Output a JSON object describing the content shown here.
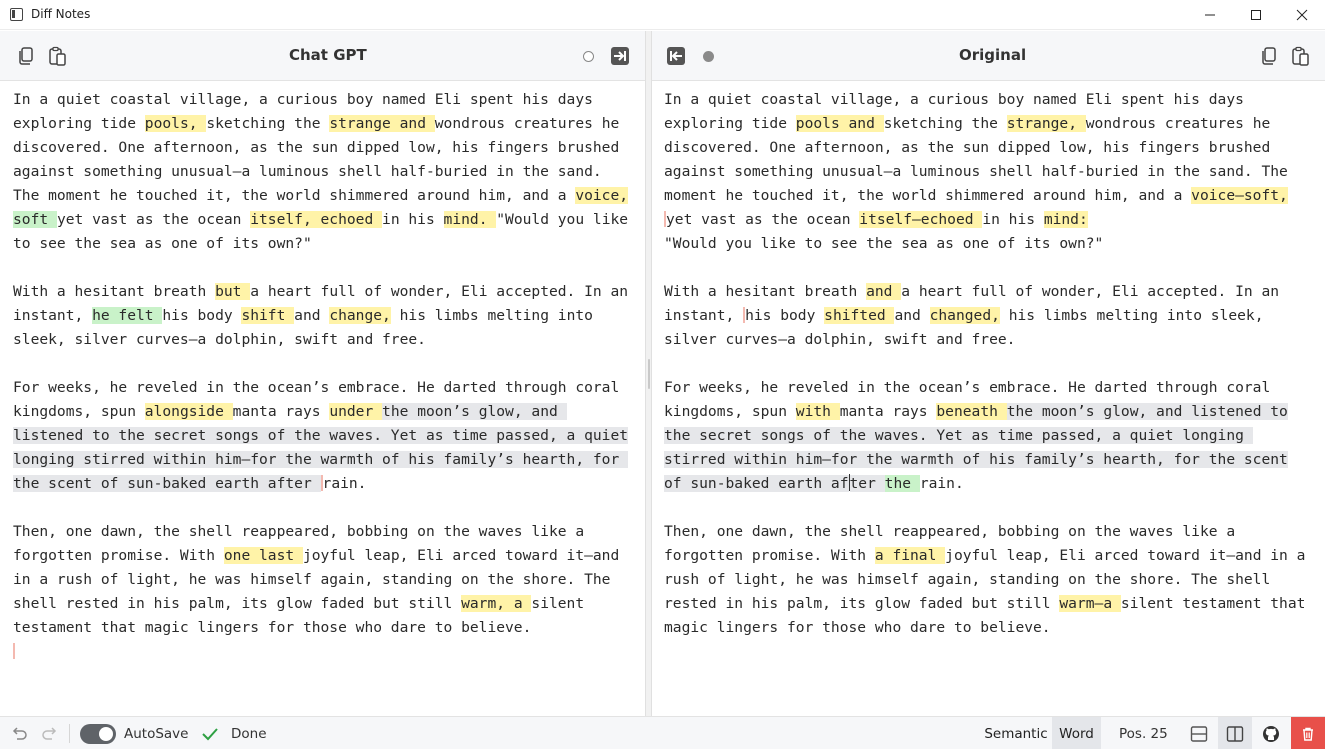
{
  "window": {
    "title": "Diff Notes"
  },
  "left_pane": {
    "title": "Chat GPT",
    "lines": [
      [
        {
          "t": "In a quiet coastal village, a curious boy named Eli spent his days"
        }
      ],
      [
        {
          "t": "exploring tide "
        },
        {
          "t": "pools, ",
          "h": "chg"
        },
        {
          "t": "sketching the "
        },
        {
          "t": "strange and ",
          "h": "chg"
        },
        {
          "t": "wondrous creatures he"
        }
      ],
      [
        {
          "t": "discovered. One afternoon, as the sun dipped low, his fingers brushed"
        }
      ],
      [
        {
          "t": "against something unusual—a luminous shell half-buried in the sand."
        }
      ],
      [
        {
          "t": "The moment he touched it, the world shimmered around him, and a "
        },
        {
          "t": "voice,",
          "h": "chg"
        }
      ],
      [
        {
          "t": "soft ",
          "h": "add"
        },
        {
          "t": "yet vast as the ocean "
        },
        {
          "t": "itself, echoed ",
          "h": "chg"
        },
        {
          "t": "in his "
        },
        {
          "t": "mind. ",
          "h": "chg"
        },
        {
          "t": "\"Would you like"
        }
      ],
      [
        {
          "t": "to see the sea as one of its own?\""
        }
      ],
      [],
      [
        {
          "t": "With a hesitant breath "
        },
        {
          "t": "but ",
          "h": "chg"
        },
        {
          "t": "a heart full of wonder, Eli accepted. In an"
        }
      ],
      [
        {
          "t": "instant, "
        },
        {
          "t": "he felt ",
          "h": "add"
        },
        {
          "t": "his body "
        },
        {
          "t": "shift ",
          "h": "chg"
        },
        {
          "t": "and "
        },
        {
          "t": "change,",
          "h": "chg"
        },
        {
          "t": " his limbs melting into"
        }
      ],
      [
        {
          "t": "sleek, silver curves—a dolphin, swift and free."
        }
      ],
      [],
      [
        {
          "t": "For weeks, he reveled in the ocean’s embrace. He darted through coral"
        }
      ],
      [
        {
          "t": "kingdoms, spun "
        },
        {
          "t": "alongside ",
          "h": "chg"
        },
        {
          "t": "manta rays "
        },
        {
          "t": "under ",
          "h": "chg"
        },
        {
          "t": "the moon’s glow, and ",
          "h": "mov"
        }
      ],
      [
        {
          "t": "listened to the secret songs of the waves. Yet as time passed, a quiet",
          "h": "mov"
        }
      ],
      [
        {
          "t": "longing stirred within him—for the warmth of his family’s hearth, for ",
          "h": "mov"
        }
      ],
      [
        {
          "t": "the scent of sun-baked earth after ",
          "h": "mov"
        },
        {
          "d": true
        },
        {
          "t": "rain."
        }
      ],
      [],
      [
        {
          "t": "Then, one dawn, the shell reappeared, bobbing on the waves like a"
        }
      ],
      [
        {
          "t": "forgotten promise. With "
        },
        {
          "t": "one last ",
          "h": "chg"
        },
        {
          "t": "joyful leap, Eli arced toward it—and"
        }
      ],
      [
        {
          "t": "in a rush of light, he was himself again, standing on the shore. The"
        }
      ],
      [
        {
          "t": "shell rested in his palm, its glow faded but still "
        },
        {
          "t": "warm, a ",
          "h": "chg"
        },
        {
          "t": "silent"
        }
      ],
      [
        {
          "t": "testament that magic lingers for those who dare to believe."
        }
      ],
      [
        {
          "d": true
        }
      ]
    ]
  },
  "right_pane": {
    "title": "Original",
    "lines": [
      [
        {
          "t": "In a quiet coastal village, a curious boy named Eli spent his days"
        }
      ],
      [
        {
          "t": "exploring tide "
        },
        {
          "t": "pools and ",
          "h": "chg"
        },
        {
          "t": "sketching the "
        },
        {
          "t": "strange, ",
          "h": "chg"
        },
        {
          "t": "wondrous creatures he"
        }
      ],
      [
        {
          "t": "discovered. One afternoon, as the sun dipped low, his fingers brushed"
        }
      ],
      [
        {
          "t": "against something unusual—a luminous shell half-buried in the sand. The"
        }
      ],
      [
        {
          "t": "moment he touched it, the world shimmered around him, and a "
        },
        {
          "t": "voice—soft,",
          "h": "chg"
        }
      ],
      [
        {
          "d": true
        },
        {
          "t": "yet vast as the ocean "
        },
        {
          "t": "itself—echoed ",
          "h": "chg"
        },
        {
          "t": "in his "
        },
        {
          "t": "mind:",
          "h": "chg"
        }
      ],
      [
        {
          "t": "\"Would you like to see the sea as one of its own?\""
        }
      ],
      [],
      [
        {
          "t": "With a hesitant breath "
        },
        {
          "t": "and ",
          "h": "chg"
        },
        {
          "t": "a heart full of wonder, Eli accepted. In an"
        }
      ],
      [
        {
          "t": "instant, "
        },
        {
          "d": true
        },
        {
          "t": "his body "
        },
        {
          "t": "shifted ",
          "h": "chg"
        },
        {
          "t": "and "
        },
        {
          "t": "changed,",
          "h": "chg"
        },
        {
          "t": " his limbs melting into sleek,"
        }
      ],
      [
        {
          "t": "silver curves—a dolphin, swift and free."
        }
      ],
      [],
      [
        {
          "t": "For weeks, he reveled in the ocean’s embrace. He darted through coral"
        }
      ],
      [
        {
          "t": "kingdoms, spun "
        },
        {
          "t": "with ",
          "h": "chg"
        },
        {
          "t": "manta rays "
        },
        {
          "t": "beneath ",
          "h": "chg"
        },
        {
          "t": "the moon’s glow, and listened to",
          "h": "mov"
        }
      ],
      [
        {
          "t": "the secret songs of the waves. Yet as time passed, a quiet longing ",
          "h": "mov"
        }
      ],
      [
        {
          "t": "stirred within him—for the warmth of his family’s hearth, for the scent",
          "h": "mov"
        }
      ],
      [
        {
          "t": "of sun-baked earth af",
          "h": "mov"
        },
        {
          "c": true
        },
        {
          "t": "ter ",
          "h": "mov"
        },
        {
          "t": "the ",
          "h": "add"
        },
        {
          "t": "rain."
        }
      ],
      [],
      [
        {
          "t": "Then, one dawn, the shell reappeared, bobbing on the waves like a"
        }
      ],
      [
        {
          "t": "forgotten promise. With "
        },
        {
          "t": "a final ",
          "h": "chg"
        },
        {
          "t": "joyful leap, Eli arced toward it—and in a"
        }
      ],
      [
        {
          "t": "rush of light, he was himself again, standing on the shore. The shell"
        }
      ],
      [
        {
          "t": "rested in his palm, its glow faded but still "
        },
        {
          "t": "warm—a ",
          "h": "chg"
        },
        {
          "t": "silent testament that"
        }
      ],
      [
        {
          "t": "magic lingers for those who dare to believe."
        }
      ]
    ]
  },
  "statusbar": {
    "autosave_label": "AutoSave",
    "autosave_on": true,
    "save_status": "Done",
    "mode_semantic": "Semantic",
    "mode_word": "Word",
    "active_mode": "Word",
    "position": "Pos. 25"
  },
  "colors": {
    "changed": "#fff3a8",
    "added": "#c9f2c9",
    "moved": "#e6e7ea",
    "deleted_marker": "#f4b9b0",
    "done_check": "#2ea043",
    "trash_bg": "#e8504a"
  },
  "icons": [
    "copy-icon",
    "paste-icon",
    "arrow-to-right-icon",
    "arrow-to-left-icon",
    "undo-icon",
    "redo-icon",
    "check-icon",
    "layout-stacked-icon",
    "layout-side-by-side-icon",
    "github-icon",
    "trash-icon",
    "minimize-icon",
    "maximize-icon",
    "close-icon"
  ]
}
